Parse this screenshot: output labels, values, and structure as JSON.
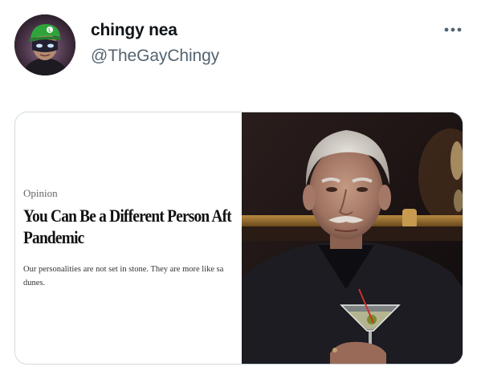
{
  "tweet": {
    "display_name": "chingy nea",
    "handle": "@TheGayChingy",
    "more_icon": "more-dots-icon"
  },
  "media": {
    "article": {
      "section": "Opinion",
      "headline_line1": "You Can Be a Different Person Aft",
      "headline_line2": "Pandemic",
      "summary_line1": "Our personalities are not set in stone. They are more like sa",
      "summary_line2": "dunes."
    },
    "photo": {
      "subject": "older-man-with-martini"
    }
  },
  "colors": {
    "name": "#0f1419",
    "handle": "#536471",
    "border": "#cfd9de"
  }
}
